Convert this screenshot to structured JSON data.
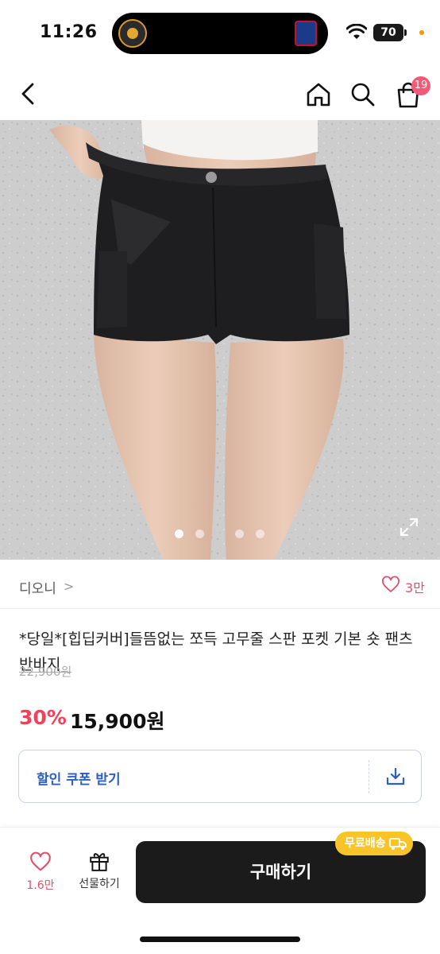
{
  "status_bar": {
    "time": "11:26",
    "battery": "70"
  },
  "nav": {
    "cart_badge": "19"
  },
  "icons": {
    "back": "chevron-left-icon",
    "home": "home-icon",
    "search": "search-icon",
    "cart": "shopping-bag-icon",
    "expand": "expand-icon",
    "heart": "heart-icon",
    "gift": "gift-icon",
    "download": "download-icon",
    "truck": "truck-icon"
  },
  "gallery": {
    "image_count": 4,
    "active_index": 0
  },
  "seller": {
    "name": "디오니",
    "chevron": ">",
    "like_count": "3만"
  },
  "product": {
    "title": "*당일*[힙딥커버]들뜸없는 쪼득 고무줄 스판 포켓 기본 숏 팬츠 반바지",
    "original_price": "22,900원",
    "discount": "30%",
    "sale_price": "15,900원"
  },
  "coupon": {
    "label": "할인 쿠폰 받기"
  },
  "bottom_bar": {
    "like_count": "1.6만",
    "gift_label": "선물하기",
    "buy_label": "구매하기",
    "free_shipping_label": "무료배송"
  },
  "colors": {
    "accent_red": "#f2415a",
    "pink": "#e0506a",
    "coupon_blue": "#2b5ec7",
    "badge_yellow": "#f7c52a",
    "buy_button": "#1b1b1b"
  }
}
